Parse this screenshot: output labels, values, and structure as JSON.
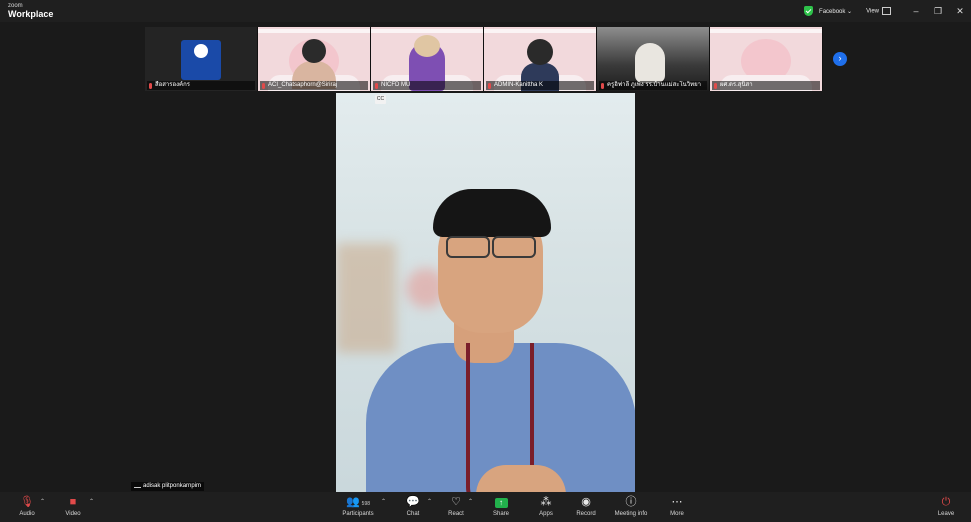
{
  "app": {
    "brand_small": "zoom",
    "brand_large": "Workplace"
  },
  "titlebar": {
    "meeting_label": "Facebook",
    "view_label": "View",
    "minimize": "–",
    "restore": "❐",
    "close": "✕"
  },
  "thumbnails": [
    {
      "name": "สื่อสารองค์กร",
      "kind": "logo"
    },
    {
      "name": "ACI_Chatsaphorn@Siriraj",
      "kind": "person"
    },
    {
      "name": "NICFD MU",
      "kind": "avatar-purple"
    },
    {
      "name": "ADMIN-Kanittha K",
      "kind": "avatar-suit"
    },
    {
      "name": "ครูอิฟาลี ภูเพ็ง รร.บ้านแม่สะโนวิทยา",
      "kind": "hijab"
    },
    {
      "name": "ผศ.ดร.สุนิสา",
      "kind": "pink"
    }
  ],
  "next_icon": "›",
  "speaker": {
    "name": "adisak plitponkarnpim",
    "cc_label": "CC"
  },
  "toolbar": {
    "audio": "Audio",
    "video": "Video",
    "participants": "Participants",
    "participants_count": "598",
    "chat": "Chat",
    "react": "React",
    "share": "Share",
    "apps": "Apps",
    "record": "Record",
    "meeting_info": "Meeting info",
    "more": "More",
    "leave": "Leave"
  },
  "colors": {
    "accent": "#1f6feb",
    "share": "#22b14c",
    "muted": "#e24a4a",
    "background": "#1a1a1a"
  }
}
